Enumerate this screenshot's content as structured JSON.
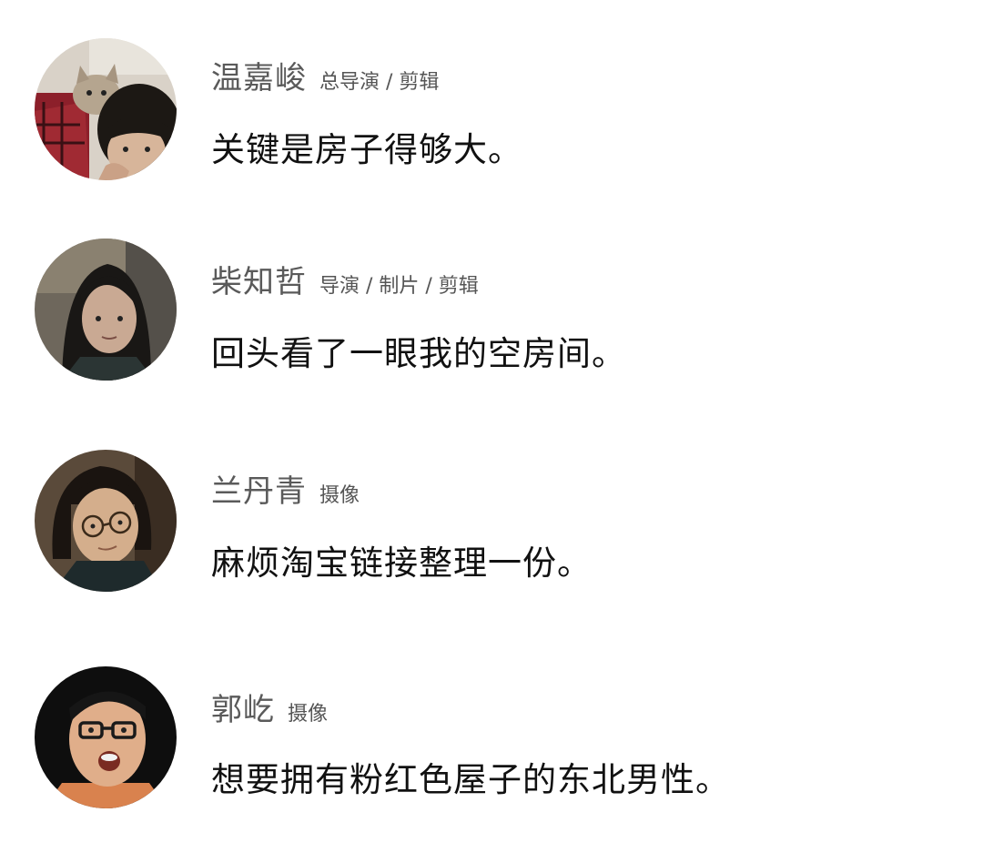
{
  "people": [
    {
      "name": "温嘉峻",
      "role": "总导演 / 剪辑",
      "quote": "关键是房子得够大。",
      "avatar_icon": "person-with-cat-avatar"
    },
    {
      "name": "柴知哲",
      "role": "导演 / 制片 / 剪辑",
      "quote": "回头看了一眼我的空房间。",
      "avatar_icon": "woman-long-hair-avatar"
    },
    {
      "name": "兰丹青",
      "role": "摄像",
      "quote": "麻烦淘宝链接整理一份。",
      "avatar_icon": "woman-glasses-avatar"
    },
    {
      "name": "郭屹",
      "role": "摄像",
      "quote": "想要拥有粉红色屋子的东北男性。",
      "avatar_icon": "man-glasses-avatar"
    }
  ]
}
